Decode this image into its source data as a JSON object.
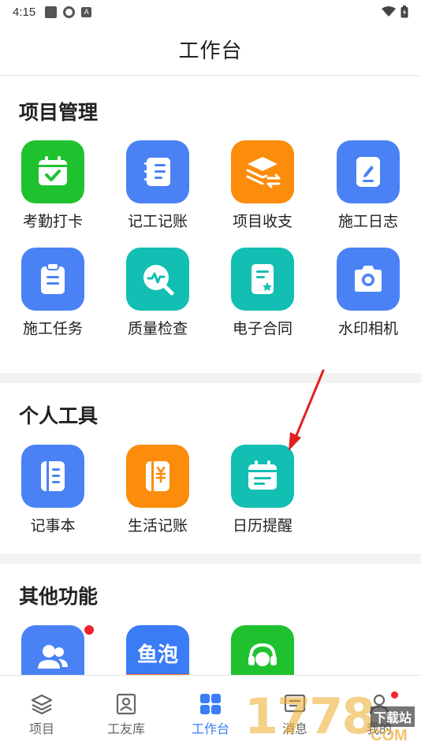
{
  "status_bar": {
    "time": "4:15",
    "a_glyph": "A"
  },
  "header": {
    "title": "工作台"
  },
  "colors": {
    "green": "#1fc22e",
    "blue": "#4a82f5",
    "orange": "#fb8c0c",
    "teal": "#12bfb2",
    "red_dot": "#f5222d",
    "active_tab": "#3a7bf6"
  },
  "sections": [
    {
      "title": "项目管理",
      "items": [
        {
          "label": "考勤打卡",
          "icon": "calendar-check-icon",
          "color": "green"
        },
        {
          "label": "记工记账",
          "icon": "notebook-list-icon",
          "color": "blue"
        },
        {
          "label": "项目收支",
          "icon": "layers-exchange-icon",
          "color": "orange"
        },
        {
          "label": "施工日志",
          "icon": "document-edit-icon",
          "color": "blue"
        },
        {
          "label": "施工任务",
          "icon": "clipboard-icon",
          "color": "blue"
        },
        {
          "label": "质量检查",
          "icon": "magnifier-pulse-icon",
          "color": "teal"
        },
        {
          "label": "电子合同",
          "icon": "contract-star-icon",
          "color": "teal"
        },
        {
          "label": "水印相机",
          "icon": "camera-icon",
          "color": "blue"
        }
      ]
    },
    {
      "title": "个人工具",
      "items": [
        {
          "label": "记事本",
          "icon": "notepad-icon",
          "color": "blue"
        },
        {
          "label": "生活记账",
          "icon": "yuan-ledger-icon",
          "color": "orange"
        },
        {
          "label": "日历提醒",
          "icon": "calendar-icon",
          "color": "teal"
        }
      ]
    },
    {
      "title": "其他功能",
      "items": [
        {
          "label": "",
          "icon": "users-icon",
          "color": "blue"
        },
        {
          "label": "",
          "icon": "yupao-logo-icon",
          "color": "blue",
          "logo_text": "鱼泡"
        },
        {
          "label": "",
          "icon": "headset-service-icon",
          "color": "green"
        }
      ]
    }
  ],
  "tabs": [
    {
      "label": "项目",
      "icon": "layers-icon",
      "active": false
    },
    {
      "label": "工友库",
      "icon": "contact-card-icon",
      "active": false
    },
    {
      "label": "工作台",
      "icon": "grid-icon",
      "active": true
    },
    {
      "label": "消息",
      "icon": "message-icon",
      "active": false
    },
    {
      "label": "我的",
      "icon": "user-icon",
      "active": false
    }
  ],
  "watermark": {
    "text": "1778",
    "sub": "下载站",
    "domain": "COM"
  }
}
